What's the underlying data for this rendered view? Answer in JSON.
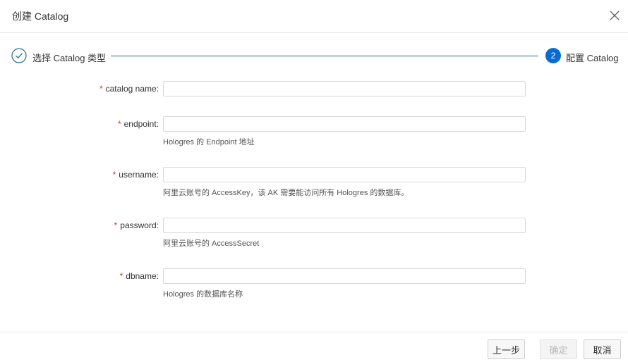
{
  "dialog": {
    "title": "创建 Catalog"
  },
  "steps": [
    {
      "label": "选择 Catalog 类型",
      "status": "done"
    },
    {
      "label": "配置 Catalog",
      "number": "2",
      "status": "active"
    }
  ],
  "form": {
    "fields": [
      {
        "label": "catalog name",
        "colon": ":",
        "required_mark": "*",
        "value": "",
        "hint": ""
      },
      {
        "label": "endpoint",
        "colon": ":",
        "required_mark": "*",
        "value": "",
        "hint": "Hologres 的 Endpoint 地址"
      },
      {
        "label": "username",
        "colon": ":",
        "required_mark": "*",
        "value": "",
        "hint": "阿里云账号的 AccessKey，该 AK 需要能访问所有 Hologres 的数据库。"
      },
      {
        "label": "password",
        "colon": ":",
        "required_mark": "*",
        "value": "",
        "hint": "阿里云账号的 AccessSecret"
      },
      {
        "label": "dbname",
        "colon": ":",
        "required_mark": "*",
        "value": "",
        "hint": "Hologres 的数据库名称"
      }
    ]
  },
  "footer": {
    "prev_label": "上一步",
    "ok_label": "确定",
    "cancel_label": "取消"
  },
  "colors": {
    "accent": "#0a6cd1",
    "required": "#d93026",
    "step_line": "#1f6e8c"
  }
}
